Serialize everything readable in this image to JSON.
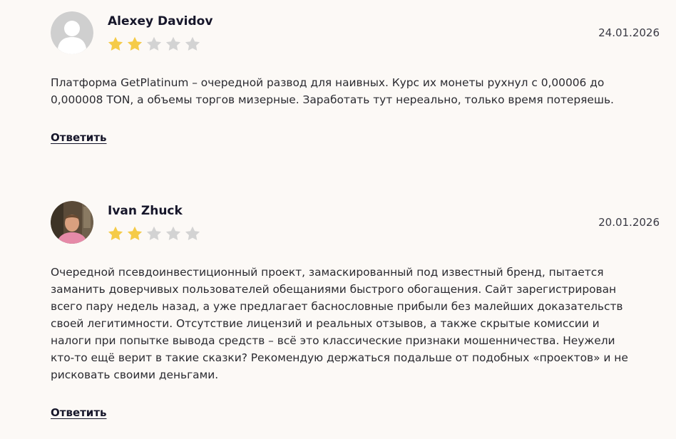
{
  "colors": {
    "background": "#fcf9f6",
    "star_filled": "#f5cb48",
    "star_empty": "#d3d3d3",
    "avatar_placeholder": "#cfcfcf"
  },
  "reviews": [
    {
      "author": "Alexey Davidov",
      "date": "24.01.2026",
      "rating": 2,
      "max_rating": 5,
      "avatar_icon": "default-user-avatar",
      "lines": [
        "Платформа GetPlatinum – очередной развод для наивных. Курс их монеты рухнул с 0,00006 до",
        "0,000008 TON, а объемы торгов мизерные. Заработать тут нереально, только время потеряешь."
      ],
      "reply_label": "Ответить"
    },
    {
      "author": "Ivan Zhuck",
      "date": "20.01.2026",
      "rating": 2,
      "max_rating": 5,
      "avatar_icon": "user-photo-avatar",
      "lines": [
        "Очередной псевдоинвестиционный проект, замаскированный под известный бренд, пытается",
        "заманить доверчивых пользователей обещаниями быстрого обогащения. Сайт зарегистрирован",
        "всего пару недель назад, а уже предлагает баснословные прибыли без малейших доказательств",
        "своей легитимности. Отсутствие лицензий и реальных отзывов, а также скрытые комиссии и",
        "налоги при попытке вывода средств – всё это классические признаки мошенничества. Неужели",
        "кто-то ещё верит в такие сказки? Рекомендую держаться подальше от подобных «проектов» и не",
        "рисковать своими деньгами."
      ],
      "reply_label": "Ответить"
    }
  ]
}
